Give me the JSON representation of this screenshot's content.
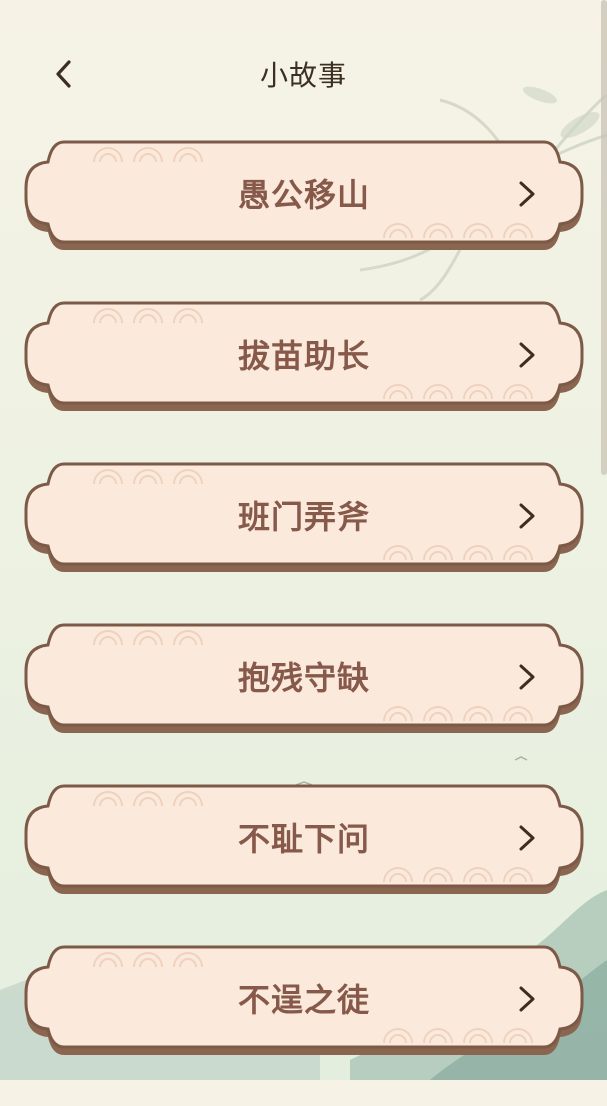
{
  "header": {
    "title": "小故事",
    "back_icon": "chevron-left-icon"
  },
  "colors": {
    "card_fill": "#fbeadc",
    "card_border": "#7c5a47",
    "card_text": "#86594a",
    "title_text": "#3d2e22"
  },
  "stories": [
    {
      "label": "愚公移山",
      "icon": "chevron-right-icon"
    },
    {
      "label": "拔苗助长",
      "icon": "chevron-right-icon"
    },
    {
      "label": "班门弄斧",
      "icon": "chevron-right-icon"
    },
    {
      "label": "抱残守缺",
      "icon": "chevron-right-icon"
    },
    {
      "label": "不耻下问",
      "icon": "chevron-right-icon"
    },
    {
      "label": "不逞之徒",
      "icon": "chevron-right-icon"
    }
  ]
}
